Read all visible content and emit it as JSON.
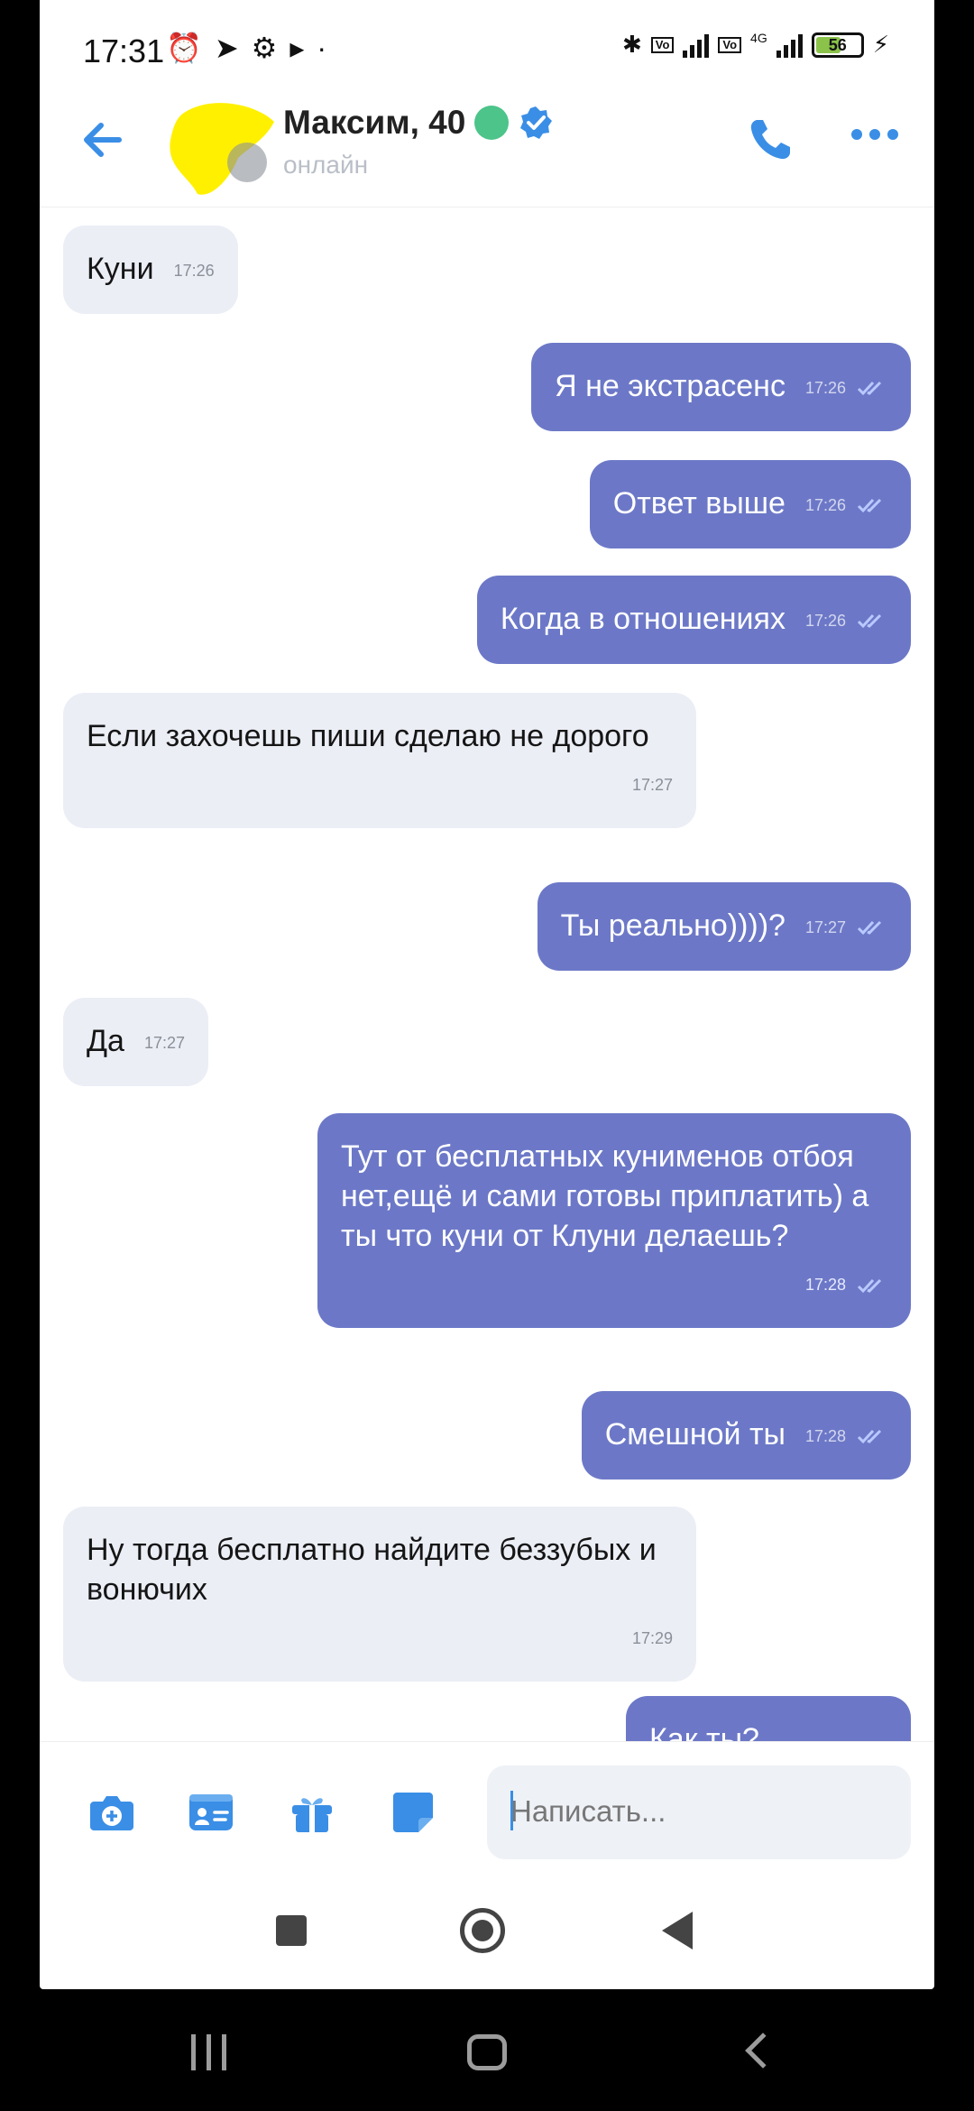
{
  "status_bar": {
    "time": "17:31",
    "network": "4G",
    "battery": "56"
  },
  "header": {
    "contact_name": "Максим, 40",
    "status": "онлайн"
  },
  "messages": [
    {
      "dir": "in",
      "text": "Куни",
      "time": "17:26"
    },
    {
      "dir": "out",
      "text": "Я не экстрасенс",
      "time": "17:26"
    },
    {
      "dir": "out",
      "text": "Ответ выше",
      "time": "17:26"
    },
    {
      "dir": "out",
      "text": "Когда в отношениях",
      "time": "17:26"
    },
    {
      "dir": "in",
      "text": "Если захочешь пиши сделаю не дорого",
      "time": "17:27"
    },
    {
      "dir": "out",
      "text": "Ты реально))))?",
      "time": "17:27"
    },
    {
      "dir": "in",
      "text": "Да",
      "time": "17:27"
    },
    {
      "dir": "out",
      "text": "Тут от бесплатных кунименов отбоя нет,ещё и сами готовы приплатить) а ты что куни от Клуни делаешь?",
      "time": "17:28"
    },
    {
      "dir": "out",
      "text": "Смешной ты",
      "time": "17:28"
    },
    {
      "dir": "in",
      "text": "Ну тогда бесплатно найдите беззубых и вонючих",
      "time": "17:29"
    },
    {
      "dir": "out",
      "text": "Как ты?",
      "time": ""
    }
  ],
  "composer": {
    "placeholder": "Написать..."
  },
  "colors": {
    "outgoing_bubble": "#6c78c7",
    "incoming_bubble": "#ebeef5",
    "accent": "#3a8ee6",
    "online": "#4cc48a"
  },
  "icons": [
    "back-arrow-icon",
    "verified-icon",
    "phone-icon",
    "more-icon",
    "camera-icon",
    "contact-card-icon",
    "gift-icon",
    "sticker-icon"
  ]
}
